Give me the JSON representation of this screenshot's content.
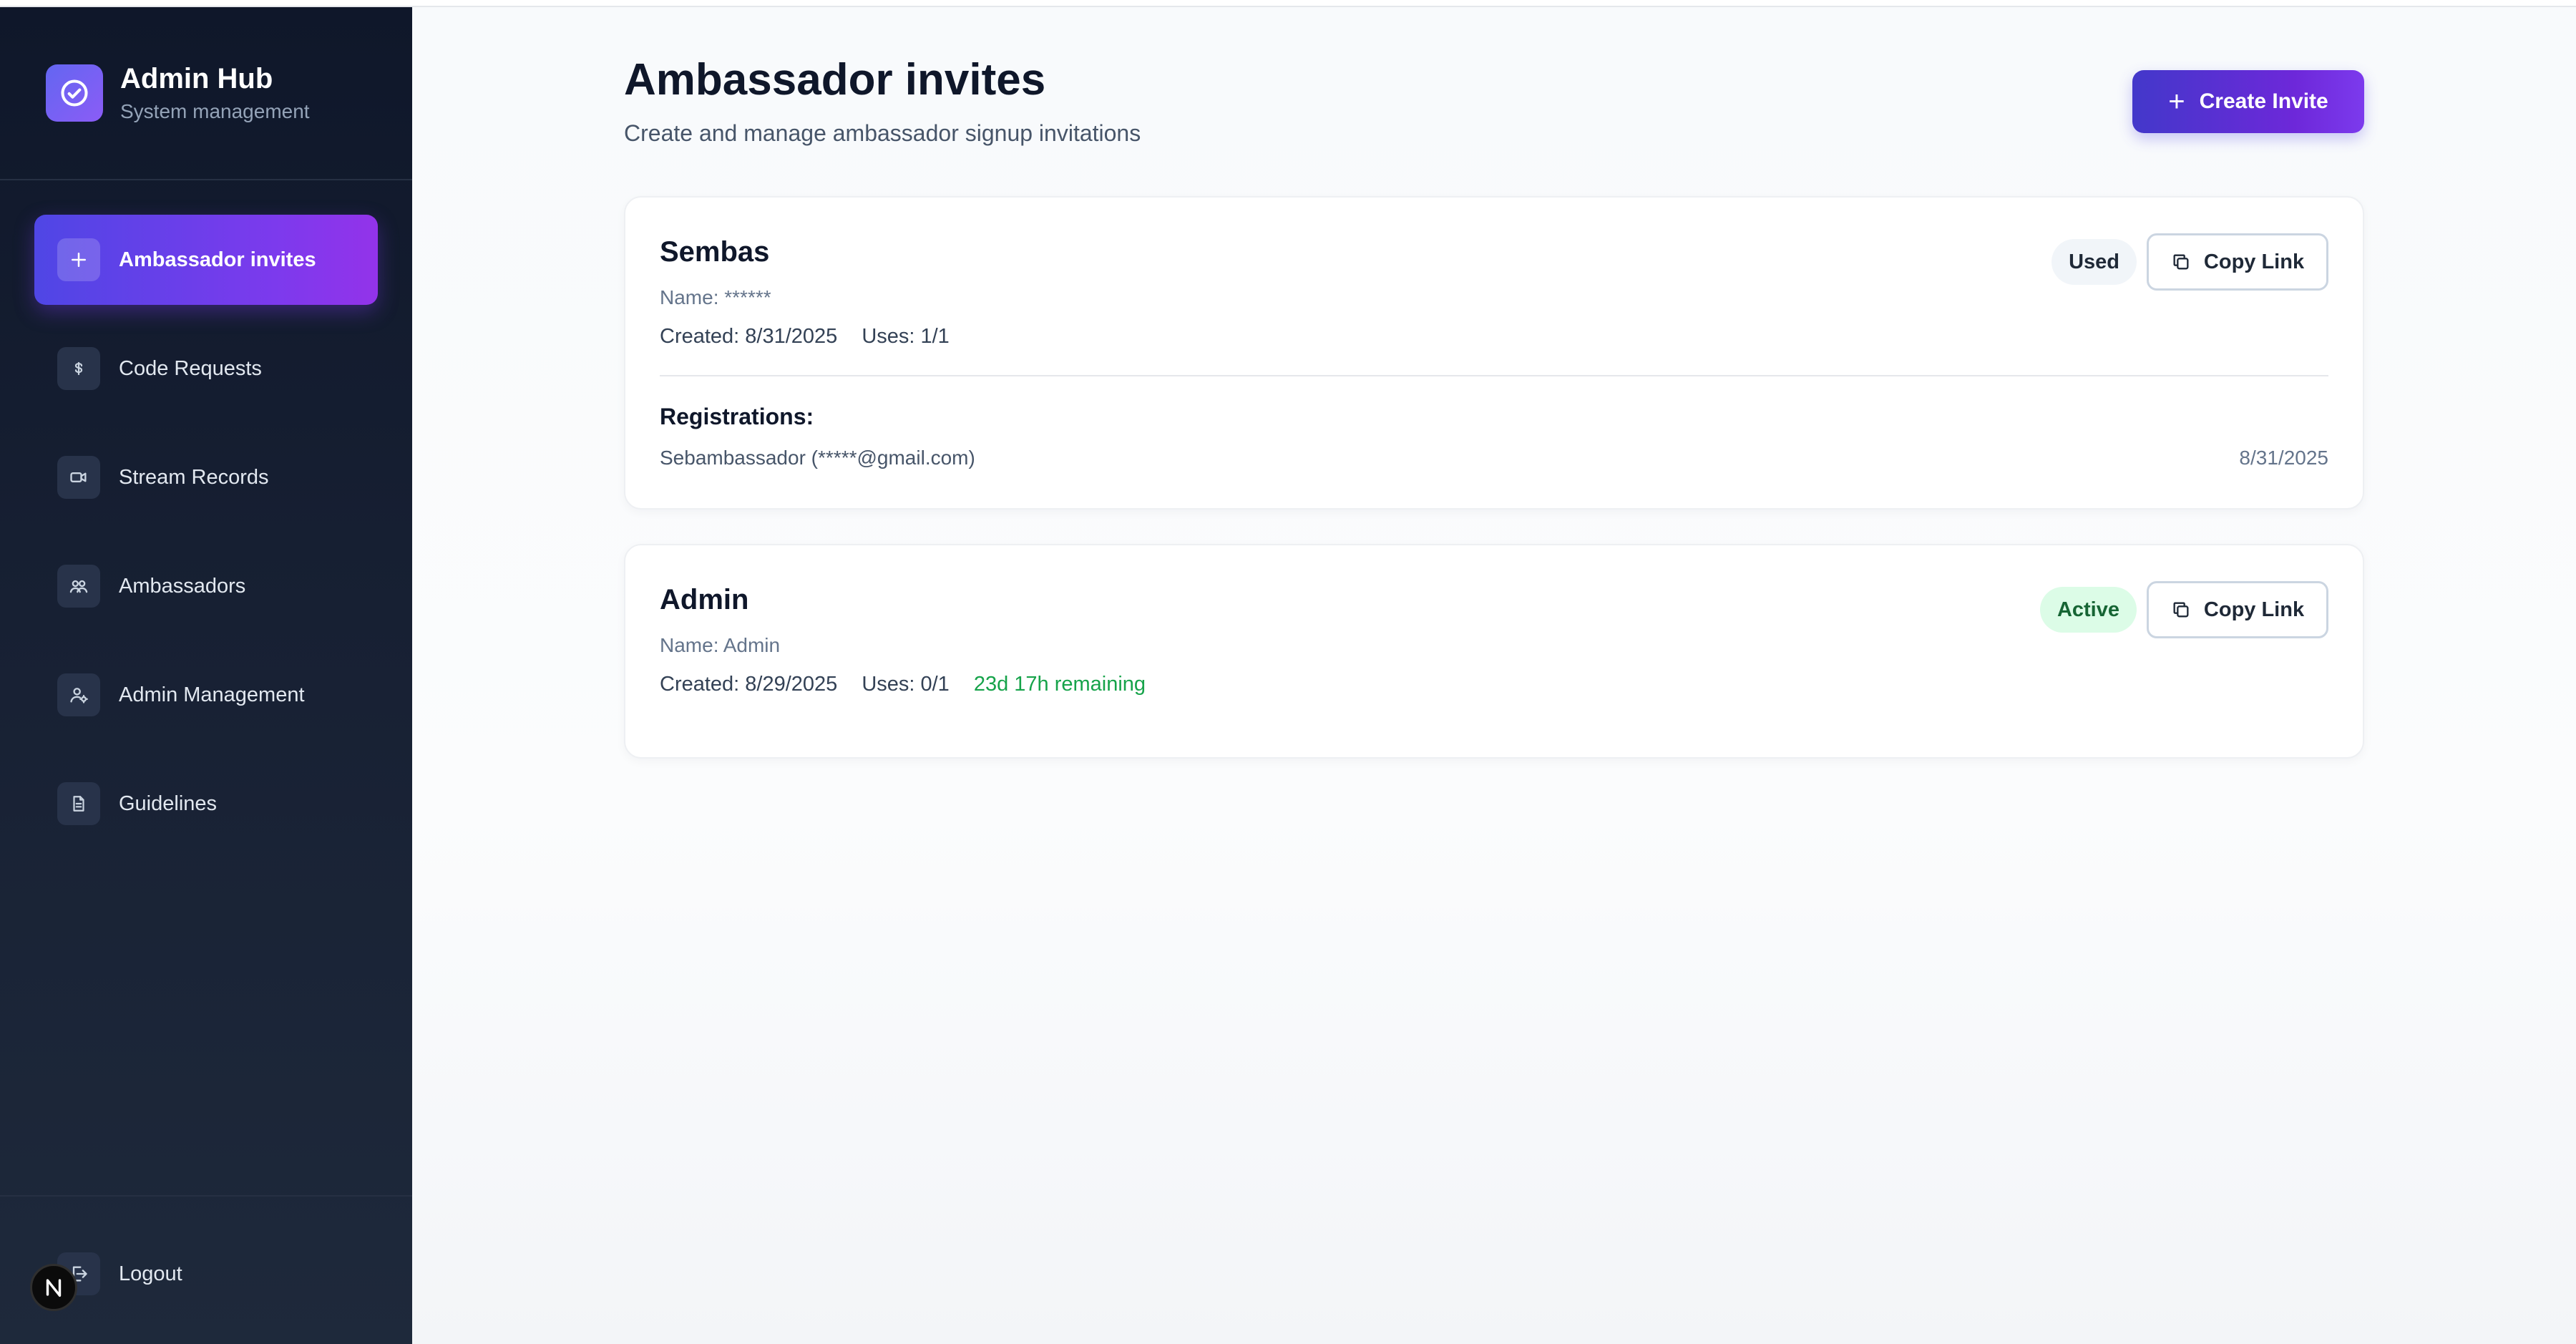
{
  "brand": {
    "title": "Admin Hub",
    "subtitle": "System management"
  },
  "sidebar": {
    "items": [
      {
        "label": "Ambassador invites",
        "icon": "plus-icon",
        "active": true
      },
      {
        "label": "Code Requests",
        "icon": "dollar-icon",
        "active": false
      },
      {
        "label": "Stream Records",
        "icon": "video-icon",
        "active": false
      },
      {
        "label": "Ambassadors",
        "icon": "users-icon",
        "active": false
      },
      {
        "label": "Admin Management",
        "icon": "user-cog-icon",
        "active": false
      },
      {
        "label": "Guidelines",
        "icon": "document-icon",
        "active": false
      }
    ],
    "logout_label": "Logout"
  },
  "page": {
    "title": "Ambassador invites",
    "subtitle": "Create and manage ambassador signup invitations",
    "create_button": "Create Invite"
  },
  "invites": [
    {
      "title": "Sembas",
      "name": "Name: ******",
      "created": "Created: 8/31/2025",
      "uses": "Uses: 1/1",
      "status": "Used",
      "copy_label": "Copy Link",
      "registrations_heading": "Registrations:",
      "registrations": [
        {
          "user": "Sebambassador (*****@gmail.com)",
          "date": "8/31/2025"
        }
      ]
    },
    {
      "title": "Admin",
      "name": "Name: Admin",
      "created": "Created: 8/29/2025",
      "uses": "Uses: 0/1",
      "remaining": "23d 17h remaining",
      "status": "Active",
      "copy_label": "Copy Link"
    }
  ],
  "colors": {
    "accent": "#6d28d9",
    "sidebar_bg": "#0f172a",
    "status_used_bg": "#f1f5f9",
    "status_active_bg": "#dcfce7",
    "remaining_text": "#16a34a"
  }
}
